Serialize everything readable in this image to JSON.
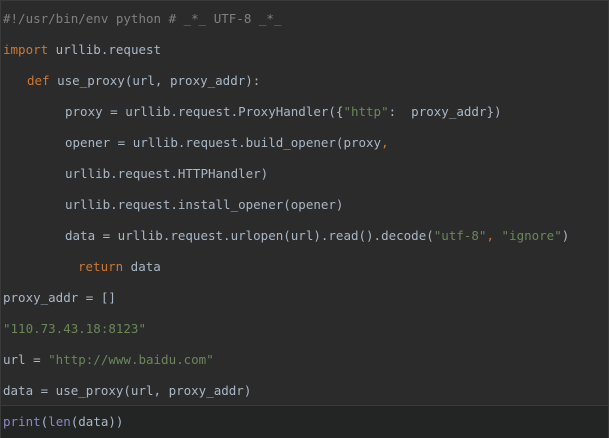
{
  "editor": {
    "lines": [
      {
        "segments": [
          {
            "t": "#!/usr/bin/env python # _*_ UTF-8 _*_",
            "c": "cmt"
          }
        ]
      },
      {
        "segments": [
          {
            "t": "import",
            "c": "kw"
          },
          {
            "t": " urllib.request",
            "c": "plain"
          }
        ]
      },
      {
        "segments": [
          {
            "t": "def",
            "c": "kw"
          },
          {
            "t": " use_proxy(url, proxy_addr):",
            "c": "plain"
          }
        ]
      },
      {
        "segments": [
          {
            "t": "proxy = urllib.request.ProxyHandler({",
            "c": "plain"
          },
          {
            "t": "\"http\"",
            "c": "str"
          },
          {
            "t": ":  proxy_addr})",
            "c": "plain"
          }
        ]
      },
      {
        "segments": [
          {
            "t": "opener = urllib.request.build_opener(proxy",
            "c": "plain"
          },
          {
            "t": ",",
            "c": "kw"
          }
        ]
      },
      {
        "segments": [
          {
            "t": "urllib.request.HTTPHandler)",
            "c": "plain"
          }
        ]
      },
      {
        "segments": [
          {
            "t": "urllib.request.install_opener(opener)",
            "c": "plain"
          }
        ]
      },
      {
        "segments": [
          {
            "t": "data = urllib.request.urlopen(url).read().decode(",
            "c": "plain"
          },
          {
            "t": "\"utf-8\"",
            "c": "str"
          },
          {
            "t": ", ",
            "c": "kw"
          },
          {
            "t": "\"ignore\"",
            "c": "str"
          },
          {
            "t": ")",
            "c": "plain"
          }
        ]
      },
      {
        "segments": [
          {
            "t": "return",
            "c": "kw"
          },
          {
            "t": " data",
            "c": "plain"
          }
        ]
      },
      {
        "segments": [
          {
            "t": "proxy_addr = []",
            "c": "plain"
          }
        ]
      },
      {
        "segments": [
          {
            "t": "\"110.73.43.18:8123\"",
            "c": "str"
          }
        ]
      },
      {
        "segments": [
          {
            "t": "url = ",
            "c": "plain"
          },
          {
            "t": "\"http://www.baidu.com\"",
            "c": "str"
          }
        ]
      },
      {
        "segments": [
          {
            "t": "data = use_proxy(url, proxy_addr)",
            "c": "plain"
          }
        ]
      },
      {
        "segments": [
          {
            "t": "print",
            "c": "builtin"
          },
          {
            "t": "(",
            "c": "plain"
          },
          {
            "t": "len",
            "c": "builtin"
          },
          {
            "t": "(data))",
            "c": "plain"
          }
        ]
      }
    ]
  }
}
